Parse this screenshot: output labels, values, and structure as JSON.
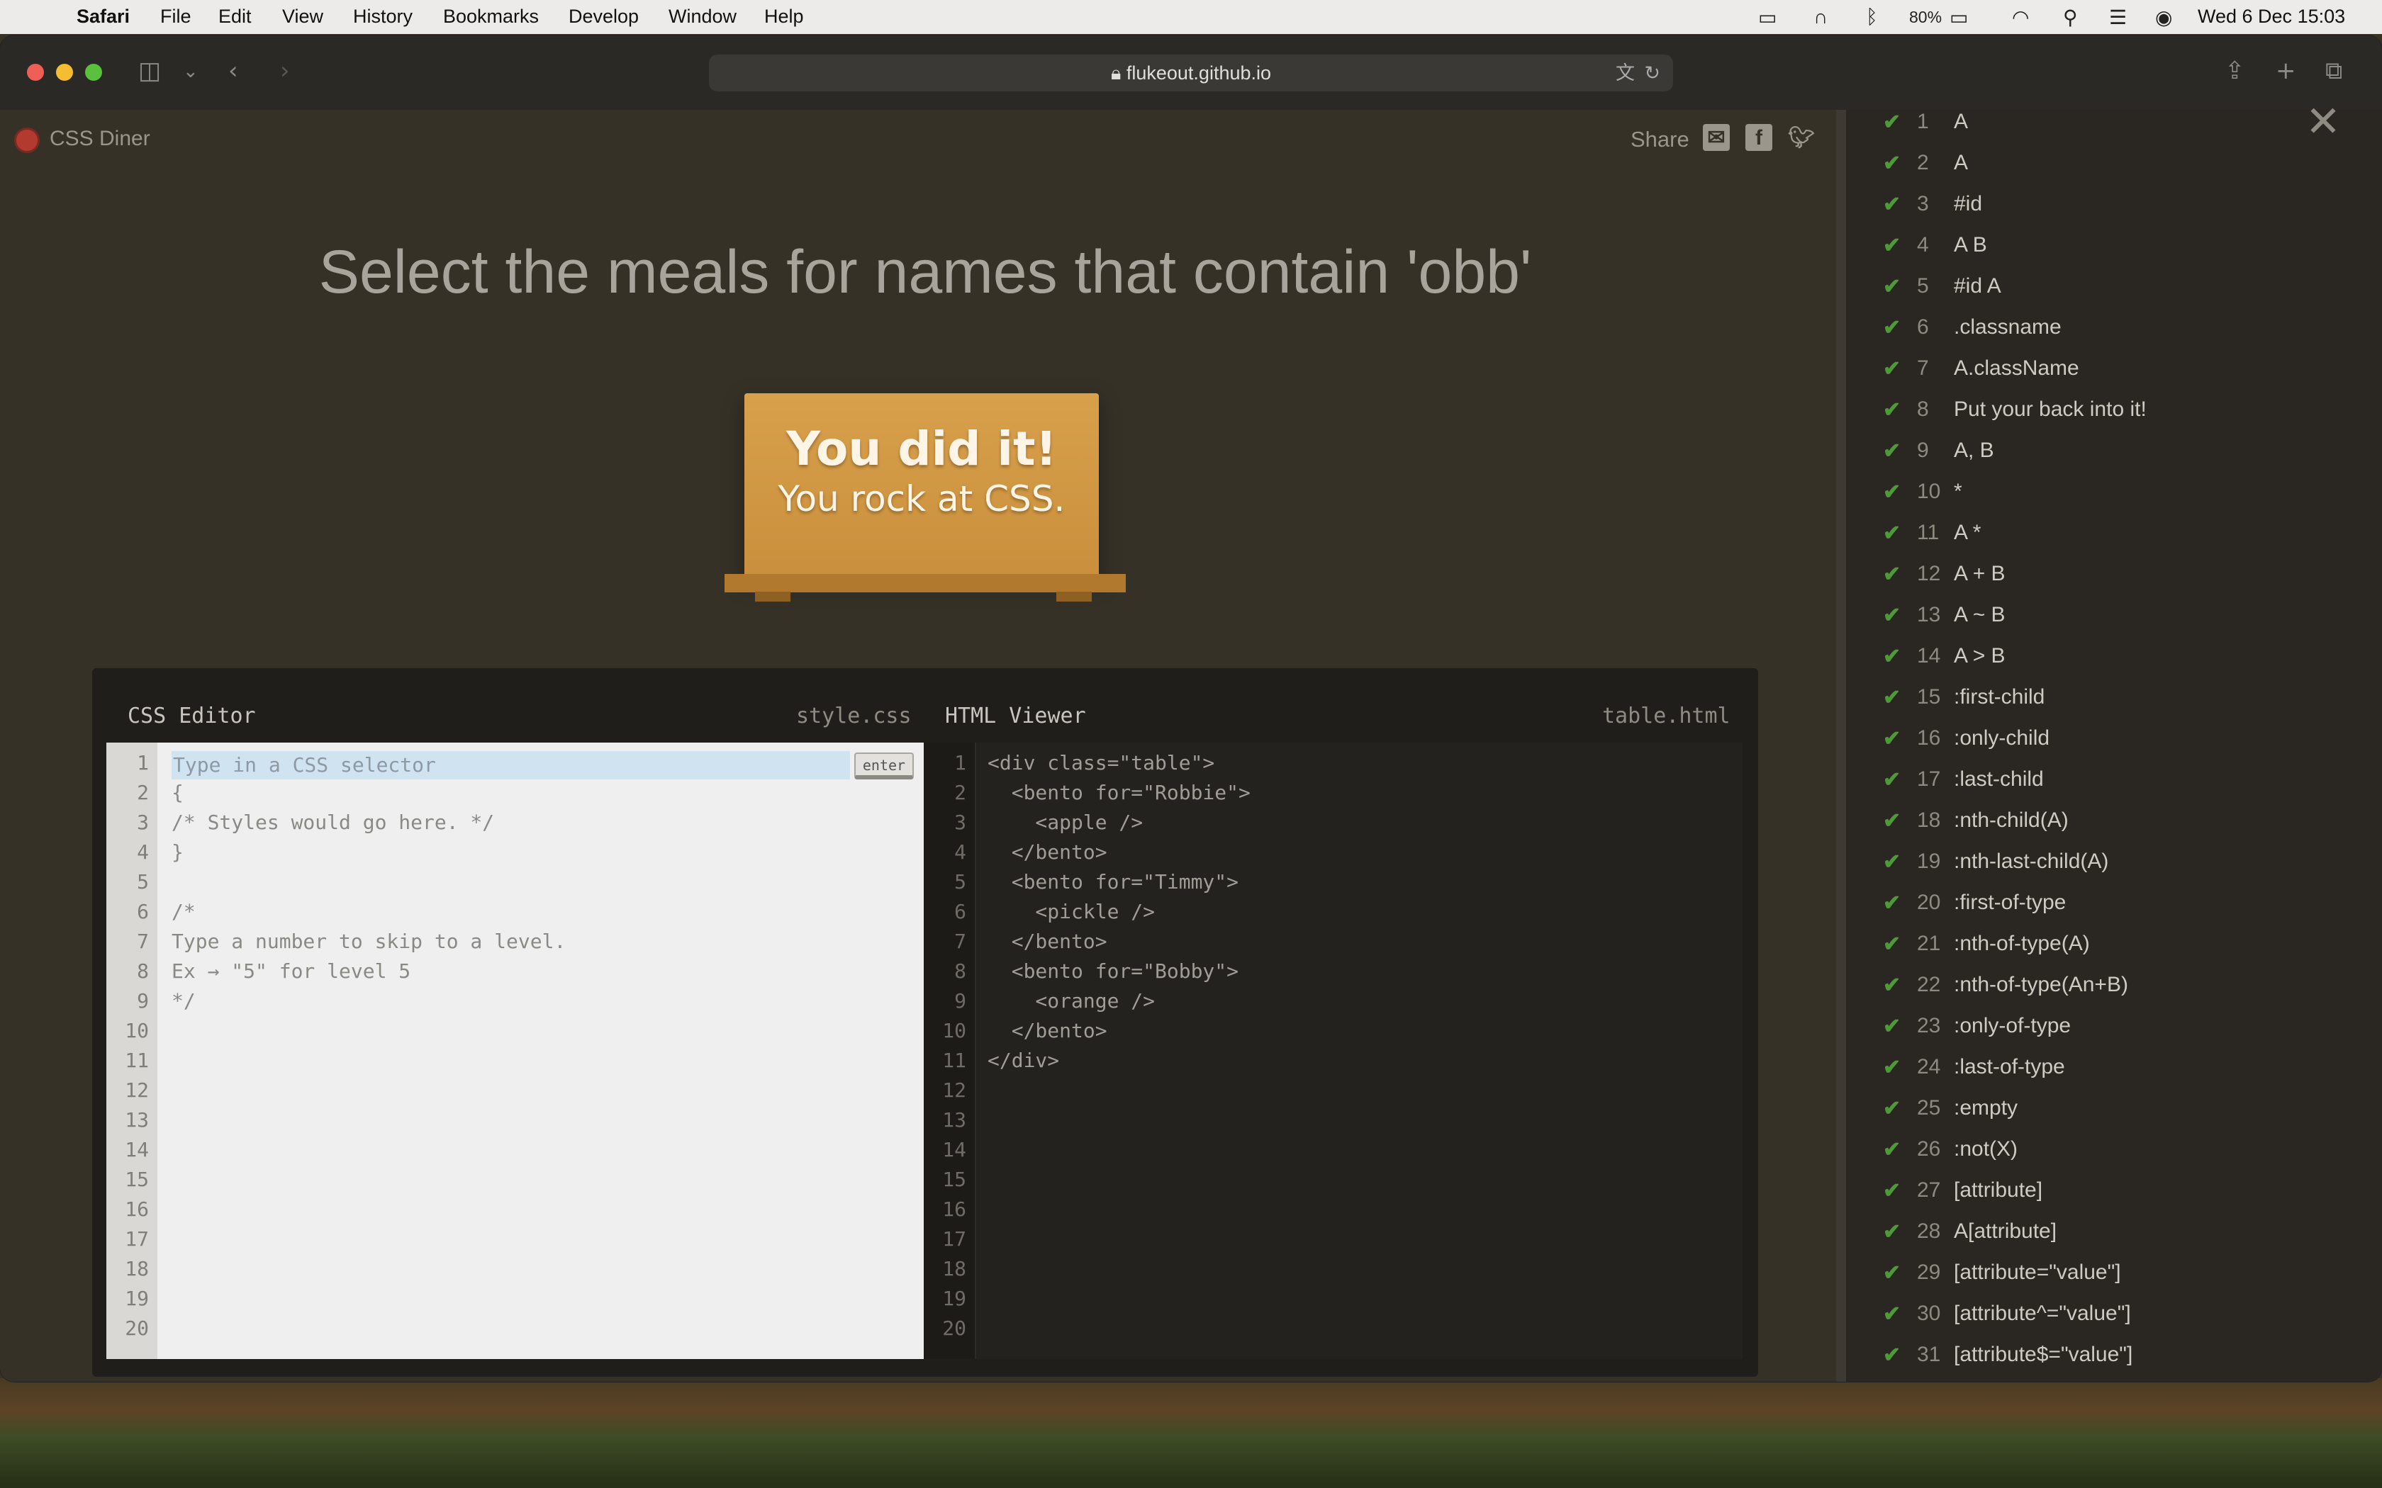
{
  "menubar": {
    "app": "Safari",
    "items": [
      "File",
      "Edit",
      "View",
      "History",
      "Bookmarks",
      "Develop",
      "Window",
      "Help"
    ],
    "battery": "80%",
    "datetime": "Wed 6 Dec  15:03"
  },
  "browser": {
    "url": "flukeout.github.io"
  },
  "page": {
    "logo": "CSS Diner",
    "share": "Share",
    "headline": "Select the meals for names that contain 'obb'",
    "win_line1": "You did it!",
    "win_line2": "You rock at CSS."
  },
  "css_editor": {
    "title": "CSS Editor",
    "file": "style.css",
    "input_placeholder": "Type in a CSS selector",
    "enter": "enter",
    "lines": [
      "{",
      "/* Styles would go here. */",
      "}",
      "",
      "/*",
      "Type a number to skip to a level.",
      "Ex → \"5\" for level 5",
      "*/"
    ]
  },
  "html_viewer": {
    "title": "HTML Viewer",
    "file": "table.html",
    "lines": [
      "<div class=\"table\">",
      "  <bento for=\"Robbie\">",
      "    <apple />",
      "  </bento>",
      "  <bento for=\"Timmy\">",
      "    <pickle />",
      "  </bento>",
      "  <bento for=\"Bobby\">",
      "    <orange />",
      "  </bento>",
      "</div>"
    ]
  },
  "levels": [
    {
      "n": "1",
      "name": "A"
    },
    {
      "n": "2",
      "name": "A"
    },
    {
      "n": "3",
      "name": "#id"
    },
    {
      "n": "4",
      "name": "A  B"
    },
    {
      "n": "5",
      "name": "#id  A"
    },
    {
      "n": "6",
      "name": ".classname"
    },
    {
      "n": "7",
      "name": "A.className"
    },
    {
      "n": "8",
      "name": "Put your back into it!"
    },
    {
      "n": "9",
      "name": "A, B"
    },
    {
      "n": "10",
      "name": "*"
    },
    {
      "n": "11",
      "name": "A  *"
    },
    {
      "n": "12",
      "name": "A + B"
    },
    {
      "n": "13",
      "name": "A ~ B"
    },
    {
      "n": "14",
      "name": "A > B"
    },
    {
      "n": "15",
      "name": ":first-child"
    },
    {
      "n": "16",
      "name": ":only-child"
    },
    {
      "n": "17",
      "name": ":last-child"
    },
    {
      "n": "18",
      "name": ":nth-child(A)"
    },
    {
      "n": "19",
      "name": ":nth-last-child(A)"
    },
    {
      "n": "20",
      "name": ":first-of-type"
    },
    {
      "n": "21",
      "name": ":nth-of-type(A)"
    },
    {
      "n": "22",
      "name": ":nth-of-type(An+B)"
    },
    {
      "n": "23",
      "name": ":only-of-type"
    },
    {
      "n": "24",
      "name": ":last-of-type"
    },
    {
      "n": "25",
      "name": ":empty"
    },
    {
      "n": "26",
      "name": ":not(X)"
    },
    {
      "n": "27",
      "name": "[attribute]"
    },
    {
      "n": "28",
      "name": "A[attribute]"
    },
    {
      "n": "29",
      "name": "[attribute=\"value\"]"
    },
    {
      "n": "30",
      "name": "[attribute^=\"value\"]"
    },
    {
      "n": "31",
      "name": "[attribute$=\"value\"]"
    }
  ],
  "colors": {
    "check": "#4e9a39",
    "table": "#d9a04c",
    "editor_bg": "#efefef"
  }
}
